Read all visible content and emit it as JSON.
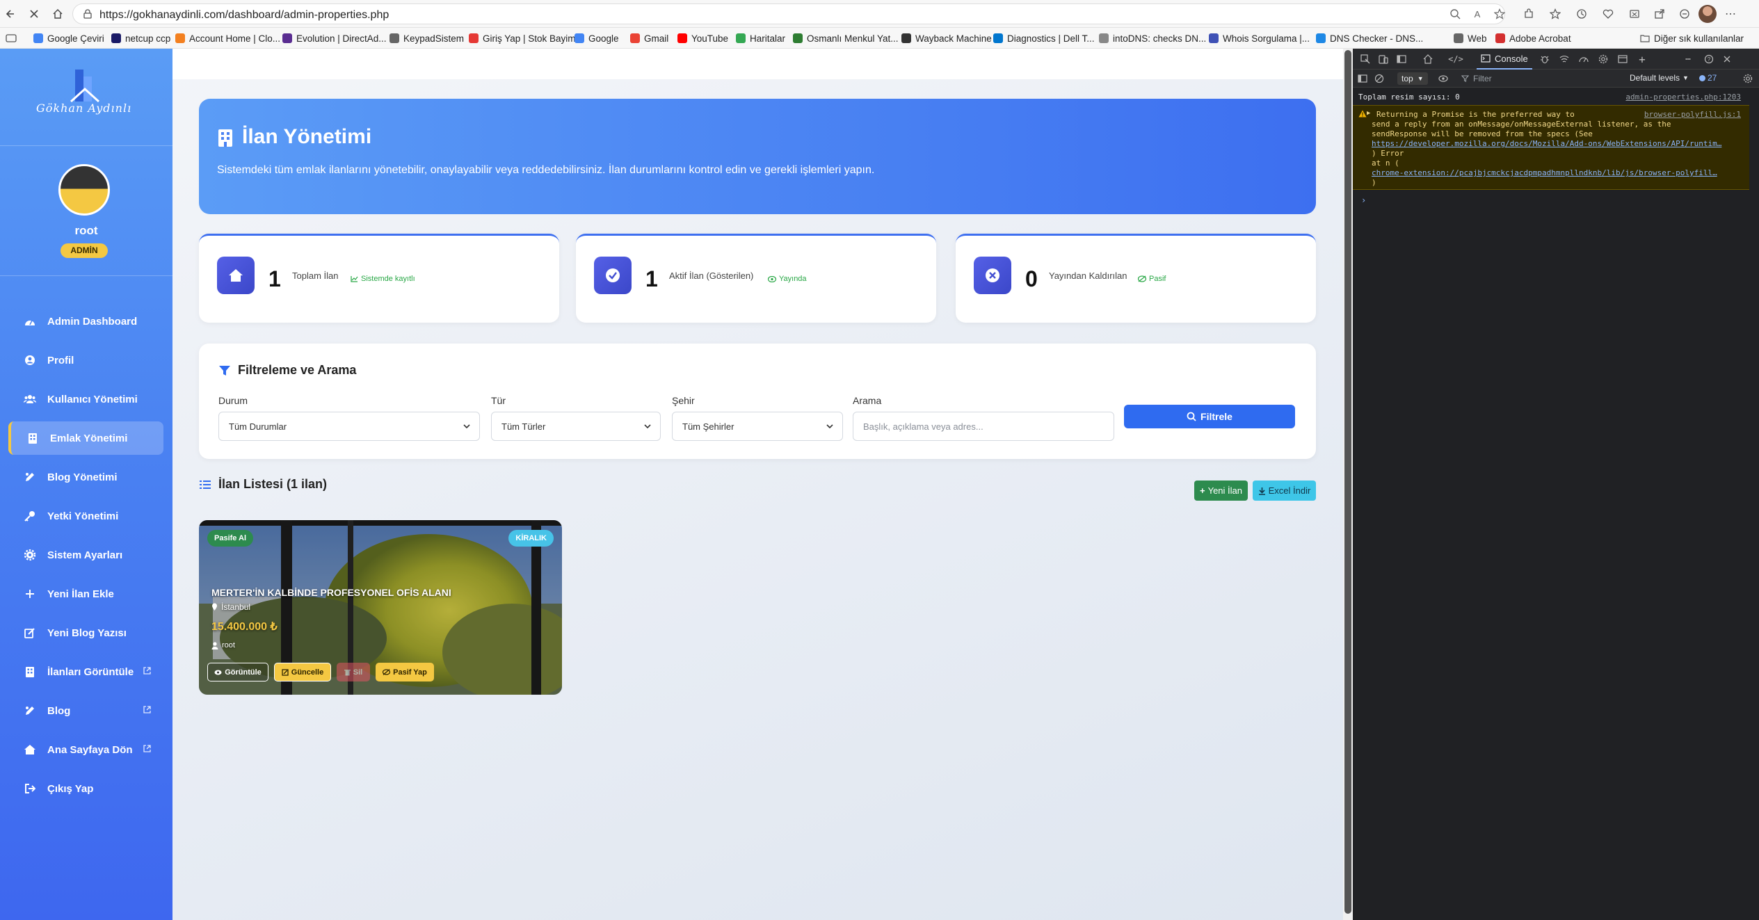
{
  "browser": {
    "url": "https://gokhanaydinli.com/dashboard/admin-properties.php",
    "bookmarks": [
      {
        "label": "Google Çeviri",
        "color": "#4285f4"
      },
      {
        "label": "netcup ccp",
        "color": "#1a1a66"
      },
      {
        "label": "Account Home | Clo...",
        "color": "#f38020"
      },
      {
        "label": "Evolution | DirectAd...",
        "color": "#5a2d91"
      },
      {
        "label": "KeypadSistem",
        "color": "#666666"
      },
      {
        "label": "Giriş Yap | Stok Bayim",
        "color": "#e53935"
      },
      {
        "label": "Google",
        "color": "#4285f4"
      },
      {
        "label": "Gmail",
        "color": "#ea4335"
      },
      {
        "label": "YouTube",
        "color": "#ff0000"
      },
      {
        "label": "Haritalar",
        "color": "#34a853"
      },
      {
        "label": "Osmanlı Menkul Yat...",
        "color": "#2e7d32"
      },
      {
        "label": "Wayback Machine",
        "color": "#333333"
      },
      {
        "label": "Diagnostics | Dell T...",
        "color": "#0076ce"
      },
      {
        "label": "intoDNS: checks DN...",
        "color": "#888888"
      },
      {
        "label": "Whois Sorgulama |...",
        "color": "#3f51b5"
      },
      {
        "label": "DNS Checker - DNS...",
        "color": "#1e88e5"
      },
      {
        "label": "Web",
        "color": "#666666"
      },
      {
        "label": "Adobe Acrobat",
        "color": "#d32f2f"
      }
    ],
    "other_bookmarks": "Diğer sık kullanılanlar"
  },
  "sidebar": {
    "logo_text": "Gökhan Aydınlı",
    "user": {
      "name": "root",
      "role": "ADMİN"
    },
    "items": [
      {
        "label": "Admin Dashboard",
        "icon": "dashboard-icon"
      },
      {
        "label": "Profil",
        "icon": "user-circle-icon"
      },
      {
        "label": "Kullanıcı Yönetimi",
        "icon": "users-icon"
      },
      {
        "label": "Emlak Yönetimi",
        "icon": "building-icon",
        "active": true
      },
      {
        "label": "Blog Yönetimi",
        "icon": "blog-icon"
      },
      {
        "label": "Yetki Yönetimi",
        "icon": "key-icon"
      },
      {
        "label": "Sistem Ayarları",
        "icon": "cog-icon"
      },
      {
        "label": "Yeni İlan Ekle",
        "icon": "plus-icon"
      },
      {
        "label": "Yeni Blog Yazısı",
        "icon": "edit-icon"
      },
      {
        "label": "İlanları Görüntüle",
        "icon": "building-icon",
        "external": true
      },
      {
        "label": "Blog",
        "icon": "blog-icon",
        "external": true
      },
      {
        "label": "Ana Sayfaya Dön",
        "icon": "home-icon",
        "external": true
      },
      {
        "label": "Çıkış Yap",
        "icon": "logout-icon"
      }
    ]
  },
  "hero": {
    "title": "İlan Yönetimi",
    "description": "Sistemdeki tüm emlak ilanlarını yönetebilir, onaylayabilir veya reddedebilirsiniz. İlan durumlarını kontrol edin ve gerekli işlemleri yapın."
  },
  "stats": [
    {
      "value": "1",
      "label": "Toplam İlan",
      "tag": "Sistemde kayıtlı"
    },
    {
      "value": "1",
      "label": "Aktif İlan (Gösterilen)",
      "tag": "Yayında"
    },
    {
      "value": "0",
      "label": "Yayından Kaldırılan",
      "tag": "Pasif"
    }
  ],
  "filter": {
    "title": "Filtreleme ve Arama",
    "status": {
      "label": "Durum",
      "value": "Tüm Durumlar"
    },
    "type": {
      "label": "Tür",
      "value": "Tüm Türler"
    },
    "city": {
      "label": "Şehir",
      "value": "Tüm Şehirler"
    },
    "search": {
      "label": "Arama",
      "placeholder": "Başlık, açıklama veya adres..."
    },
    "button": "Filtrele"
  },
  "list": {
    "title": "İlan Listesi (1 ilan)",
    "new_button": "Yeni İlan",
    "excel_button": "Excel İndir"
  },
  "property": {
    "status_badge": "Pasife Al",
    "type_badge": "KİRALIK",
    "title": "MERTER'İN KALBİNDE PROFESYONEL OFİS ALANI",
    "city": "İstanbul",
    "price": "15.400.000 ₺",
    "owner": "root",
    "btn_view": "Görüntüle",
    "btn_update": "Güncelle",
    "btn_delete": "Sil",
    "btn_passive": "Pasif Yap"
  },
  "devtools": {
    "tab": "Console",
    "context": "top",
    "filter_placeholder": "Filter",
    "levels": "Default levels",
    "issues_count": "27",
    "log1": "Toplam resim sayısı: 0",
    "log1_src": "admin-properties.php:1203",
    "warn_src": "browser-polyfill.js:1",
    "warn_lines": [
      "Returning a Promise is the preferred way to",
      "send a reply from an onMessage/onMessageExternal listener, as the",
      "sendResponse will be removed from the specs (See",
      "https://developer.mozilla.org/docs/Mozilla/Add-ons/WebExtensions/API/runtim…",
      ") Error",
      "    at n (",
      "chrome-extension://pcajbjcmckcjacdpmpadhmnpllndknb/lib/js/browser-polyfill…",
      ")"
    ]
  }
}
